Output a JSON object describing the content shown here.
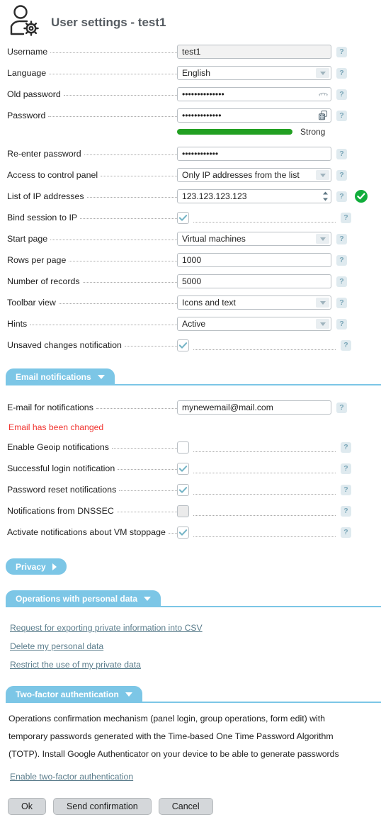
{
  "header": {
    "title": "User settings - test1",
    "icon": "user-gear-icon"
  },
  "general": {
    "rows": [
      {
        "label": "Username",
        "type": "text-readonly",
        "value": "test1",
        "help": "?"
      },
      {
        "label": "Language",
        "type": "select",
        "value": "English",
        "help": "?"
      },
      {
        "label": "Old password",
        "type": "password",
        "value": "••••••••••••••",
        "icon": "eye-icon",
        "help": "?"
      },
      {
        "label": "Password",
        "type": "password",
        "value": "•••••••••••••",
        "icon": "dice-icon",
        "help": "?"
      },
      {
        "label": "Re-enter password",
        "type": "password",
        "value": "••••••••••••",
        "help": "?"
      },
      {
        "label": "Access to control panel",
        "type": "select",
        "value": "Only IP addresses from the list",
        "help": "?"
      },
      {
        "label": "List of IP addresses",
        "type": "spinner",
        "value": "123.123.123.123",
        "help": "?",
        "status": "valid-check"
      },
      {
        "label": "Bind session to IP",
        "type": "checkbox",
        "checked": true,
        "help": "?"
      },
      {
        "label": "Start page",
        "type": "select",
        "value": "Virtual machines",
        "help": "?"
      },
      {
        "label": "Rows per page",
        "type": "text",
        "value": "1000",
        "help": "?"
      },
      {
        "label": "Number of records",
        "type": "text",
        "value": "5000",
        "help": "?"
      },
      {
        "label": "Toolbar view",
        "type": "select",
        "value": "Icons and text",
        "help": "?"
      },
      {
        "label": "Hints",
        "type": "select",
        "value": "Active",
        "help": "?"
      },
      {
        "label": "Unsaved changes notification",
        "type": "checkbox",
        "checked": true,
        "help": "?"
      }
    ],
    "password_strength": {
      "label": "Strong",
      "percent": 75,
      "color": "#22a022"
    }
  },
  "email_section": {
    "tab_label": "Email notifications",
    "expanded": true,
    "email_row": {
      "label": "E-mail for notifications",
      "value": "mynewemail@mail.com",
      "help": "?"
    },
    "error": "Email has been changed",
    "rows": [
      {
        "label": "Enable Geoip notifications",
        "checked": false,
        "disabled": false,
        "help": "?"
      },
      {
        "label": "Successful login notification",
        "checked": true,
        "disabled": false,
        "help": "?"
      },
      {
        "label": "Password reset notifications",
        "checked": true,
        "disabled": false,
        "help": "?"
      },
      {
        "label": "Notifications from DNSSEC",
        "checked": false,
        "disabled": true,
        "help": "?"
      },
      {
        "label": "Activate notifications about VM stoppage",
        "checked": true,
        "disabled": false,
        "help": "?"
      }
    ]
  },
  "privacy_section": {
    "tab_label": "Privacy",
    "expanded": false
  },
  "personal_data_section": {
    "tab_label": "Operations with personal data",
    "expanded": true,
    "links": [
      "Request for exporting private information into CSV",
      "Delete my personal data",
      "Restrict the use of my private data"
    ]
  },
  "twofa_section": {
    "tab_label": "Two-factor authentication",
    "expanded": true,
    "paragraph_lines": [
      "Operations confirmation mechanism (panel login, group operations, form edit) with",
      "temporary passwords generated with the Time-based One Time Password Algorithm",
      "(TOTP). Install Google Authenticator on your device to be able to generate passwords"
    ],
    "link": "Enable two-factor authentication"
  },
  "buttons": {
    "ok": "Ok",
    "send_confirmation": "Send confirmation",
    "cancel": "Cancel"
  },
  "colors": {
    "accent": "#7cc6e6",
    "error": "#f0332f",
    "strength": "#22a022",
    "help_bg": "#dfeaef",
    "link": "#5b7d8c"
  }
}
